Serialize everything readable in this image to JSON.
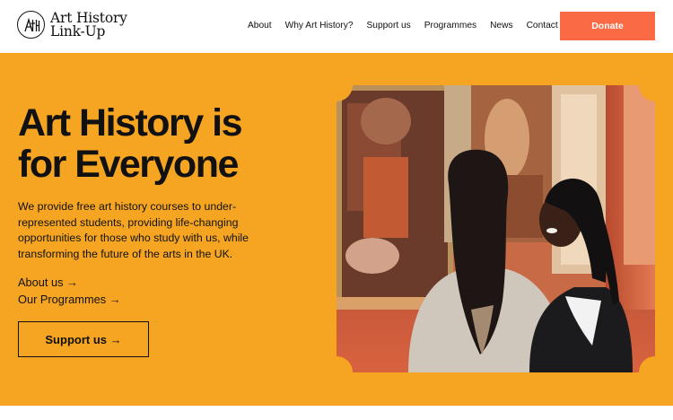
{
  "header": {
    "logo": {
      "line1": "Art History",
      "line2": "Link-Up"
    },
    "nav": [
      "About",
      "Why Art History?",
      "Support us",
      "Programmes",
      "News",
      "Contact"
    ],
    "donate_label": "Donate"
  },
  "hero": {
    "title_line1": "Art History is",
    "title_line2": "for Everyone",
    "description": "We provide free art history courses to under-represented students, providing life-changing opportunities for those who study with us, while transforming the future of the arts in the UK.",
    "link_about": "About us →",
    "link_programmes": "Our Programmes →",
    "support_label": "Support us →"
  },
  "colors": {
    "hero_bg": "#f6a522",
    "donate_bg": "#fa6a44",
    "text": "#111111"
  },
  "icons": [
    "logo-monogram-icon"
  ]
}
